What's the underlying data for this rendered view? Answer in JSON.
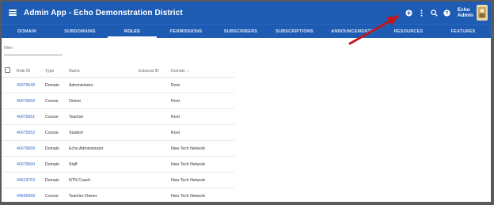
{
  "app_title": "Admin App - Echo Demonstration District",
  "user": {
    "line1": "Echo",
    "line2": "Admin"
  },
  "icons": {
    "menu": "hamburger-menu-icon",
    "add": "add-circle-icon",
    "more": "more-vert-icon",
    "search": "search-icon",
    "help": "help-icon",
    "avatar": "avatar-icon",
    "sort": "arrow-down-icon"
  },
  "colors": {
    "appbar": "#1e5bb3",
    "link": "#2f68c6",
    "arrow": "#c0171e"
  },
  "tabs": [
    {
      "label": "DOMAIN"
    },
    {
      "label": "SUBDOMAINS"
    },
    {
      "label": "ROLES",
      "active": true
    },
    {
      "label": "PERMISSIONS"
    },
    {
      "label": "SUBSCRIBERS"
    },
    {
      "label": "SUBSCRIPTIONS"
    },
    {
      "label": "ANNOUNCEMENTS"
    },
    {
      "label": "RESOURCES"
    },
    {
      "label": "FEATURES"
    }
  ],
  "filter": {
    "placeholder": "Filter"
  },
  "table": {
    "headers": {
      "role_id": "Role ID",
      "type": "Type",
      "name": "Name",
      "external_id": "External ID",
      "domain": "Domain"
    },
    "rows": [
      {
        "role_id": "40079549",
        "type": "Domain",
        "name": "Administrator",
        "external_id": "",
        "domain": "Root"
      },
      {
        "role_id": "40079550",
        "type": "Course",
        "name": "Owner",
        "external_id": "",
        "domain": "Root"
      },
      {
        "role_id": "40079551",
        "type": "Course",
        "name": "Teacher",
        "external_id": "",
        "domain": "Root"
      },
      {
        "role_id": "40079552",
        "type": "Course",
        "name": "Student",
        "external_id": "",
        "domain": "Root"
      },
      {
        "role_id": "40079658",
        "type": "Domain",
        "name": "Echo Administrator",
        "external_id": "",
        "domain": "New Tech Network"
      },
      {
        "role_id": "40079660",
        "type": "Domain",
        "name": "Staff",
        "external_id": "",
        "domain": "New Tech Network"
      },
      {
        "role_id": "44613763",
        "type": "Domain",
        "name": "NTN Coach",
        "external_id": "",
        "domain": "New Tech Network"
      },
      {
        "role_id": "44655068",
        "type": "Course",
        "name": "Teacher-Owner",
        "external_id": "",
        "domain": "New Tech Network"
      }
    ]
  }
}
